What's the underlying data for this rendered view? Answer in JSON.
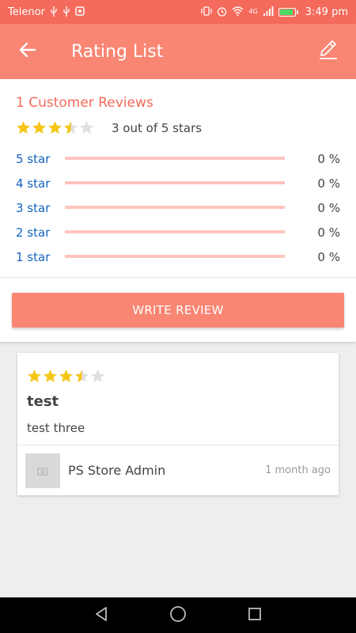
{
  "status_bar": {
    "carrier": "Telenor",
    "time": "3:49 pm",
    "network": "4G"
  },
  "app_bar": {
    "title": "Rating List",
    "back_icon": "arrow-back-icon",
    "edit_icon": "edit-pencil-icon"
  },
  "summary": {
    "title": "1 Customer Reviews",
    "average_rating": 3.5,
    "average_text": "3 out of 5 stars",
    "breakdown": [
      {
        "label": "5 star",
        "percent_text": "0 %",
        "value": 0
      },
      {
        "label": "4 star",
        "percent_text": "0 %",
        "value": 0
      },
      {
        "label": "3 star",
        "percent_text": "0 %",
        "value": 0
      },
      {
        "label": "2 star",
        "percent_text": "0 %",
        "value": 0
      },
      {
        "label": "1 star",
        "percent_text": "0 %",
        "value": 0
      }
    ],
    "write_review_label": "WRITE REVIEW"
  },
  "reviews": [
    {
      "rating": 3.5,
      "title": "test",
      "body": "test three",
      "author": "PS Store Admin",
      "time": "1 month ago"
    }
  ],
  "colors": {
    "status_bar": "#f46a5b",
    "accent": "#f98573",
    "star": "#f5c518",
    "star_empty": "#e0e0e0",
    "link_blue": "#1565c0",
    "bar_track": "#ffc4bf"
  }
}
